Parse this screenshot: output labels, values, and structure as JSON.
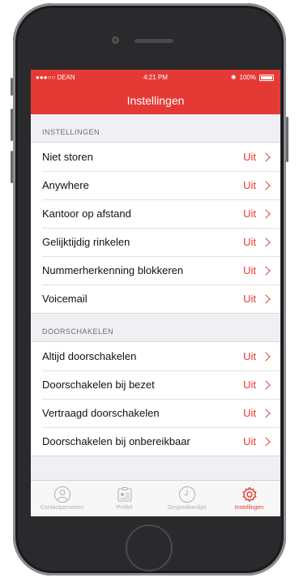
{
  "status": {
    "carrier": "●●●○○ DEAN",
    "time": "4:21 PM",
    "battery": "100%"
  },
  "nav": {
    "title": "Instellingen"
  },
  "sections": [
    {
      "header": "INSTELLINGEN",
      "items": [
        {
          "label": "Niet storen",
          "value": "Uit"
        },
        {
          "label": "Anywhere",
          "value": "Uit"
        },
        {
          "label": "Kantoor op afstand",
          "value": "Uit"
        },
        {
          "label": "Gelijktijdig rinkelen",
          "value": "Uit"
        },
        {
          "label": "Nummerherkenning blokkeren",
          "value": "Uit"
        },
        {
          "label": "Voicemail",
          "value": "Uit"
        }
      ]
    },
    {
      "header": "DOORSCHAKELEN",
      "items": [
        {
          "label": "Altijd doorschakelen",
          "value": "Uit"
        },
        {
          "label": "Doorschakelen bij bezet",
          "value": "Uit"
        },
        {
          "label": "Vertraagd doorschakelen",
          "value": "Uit"
        },
        {
          "label": "Doorschakelen bij onbereikbaar",
          "value": "Uit"
        }
      ]
    }
  ],
  "tabs": [
    {
      "label": "Contactpersonen",
      "icon": "person-icon"
    },
    {
      "label": "Profiel",
      "icon": "id-card-icon"
    },
    {
      "label": "Gesprekkenlijst",
      "icon": "clock-icon"
    },
    {
      "label": "Instellingen",
      "icon": "gear-icon"
    }
  ],
  "colors": {
    "accent": "#e53935",
    "inactive": "#b0b0b5"
  }
}
